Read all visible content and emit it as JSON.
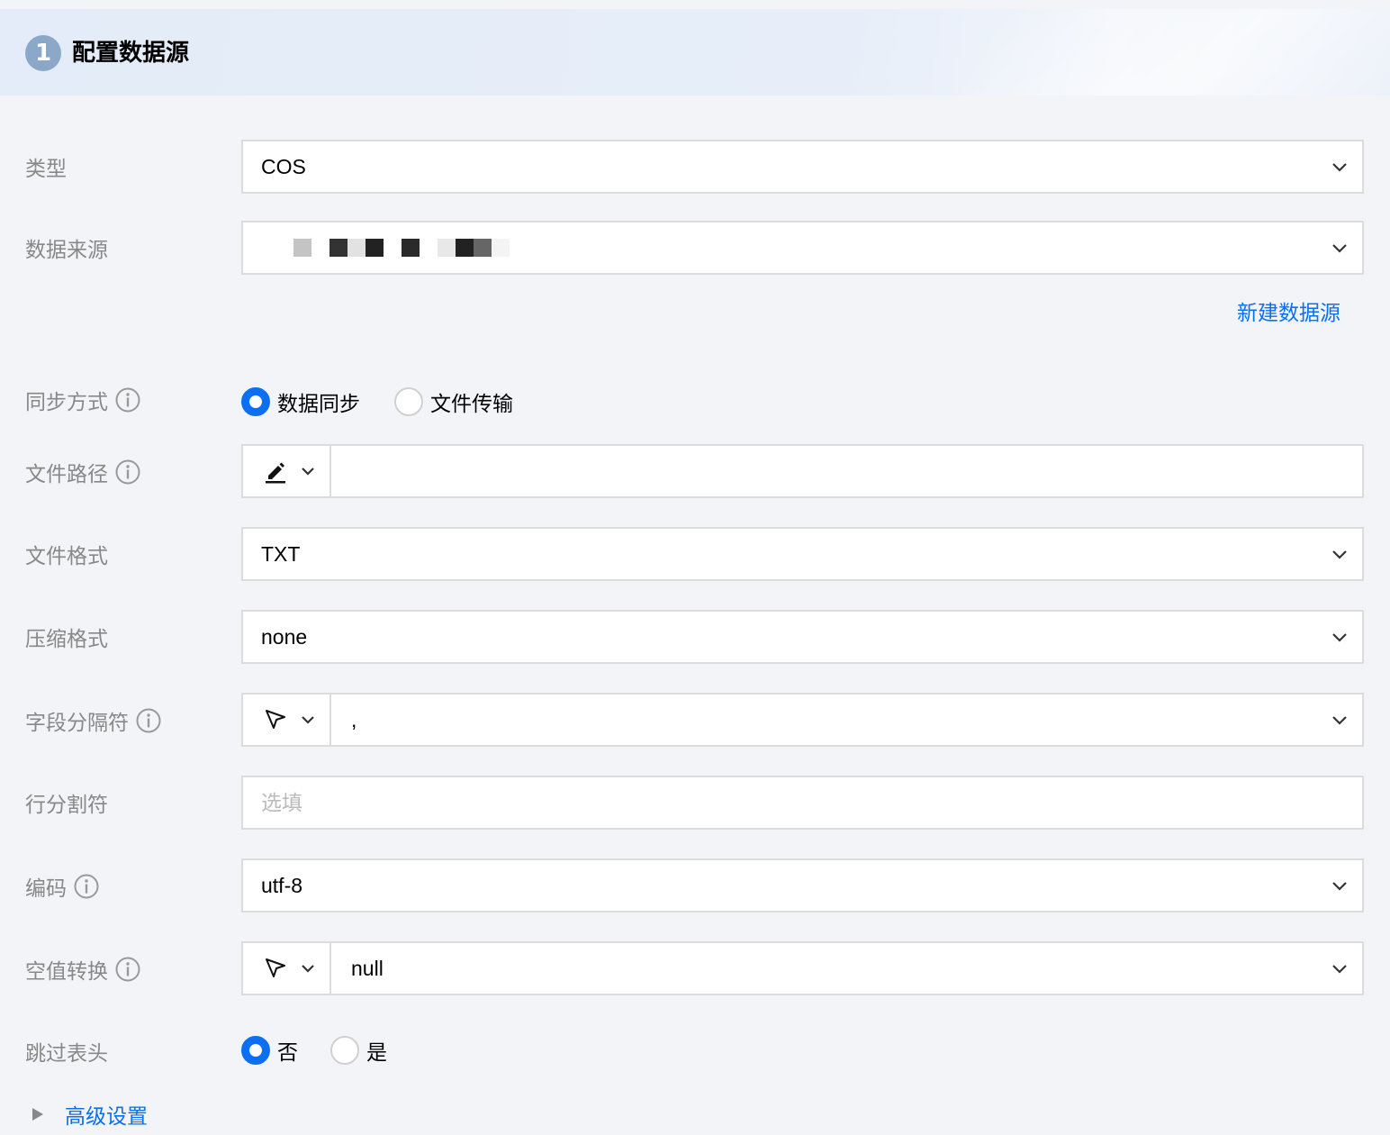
{
  "header": {
    "step": "1",
    "title": "配置数据源"
  },
  "form": {
    "type": {
      "label": "类型",
      "value": "COS"
    },
    "datasource": {
      "label": "数据来源",
      "new_link": "新建数据源"
    },
    "sync_mode": {
      "label": "同步方式",
      "options": [
        "数据同步",
        "文件传输"
      ],
      "selected": "数据同步"
    },
    "file_path": {
      "label": "文件路径",
      "value": ""
    },
    "file_format": {
      "label": "文件格式",
      "value": "TXT"
    },
    "compression": {
      "label": "压缩格式",
      "value": "none"
    },
    "field_sep": {
      "label": "字段分隔符",
      "value": ","
    },
    "row_sep": {
      "label": "行分割符",
      "placeholder": "选填"
    },
    "encoding": {
      "label": "编码",
      "value": "utf-8"
    },
    "null_conv": {
      "label": "空值转换",
      "value": "null"
    },
    "skip_header": {
      "label": "跳过表头",
      "options": [
        "否",
        "是"
      ],
      "selected": "否"
    }
  },
  "advanced": {
    "label": "高级设置"
  },
  "colors": {
    "accent": "#0a6ff0",
    "label": "#888888",
    "border": "#dcdcdc"
  }
}
